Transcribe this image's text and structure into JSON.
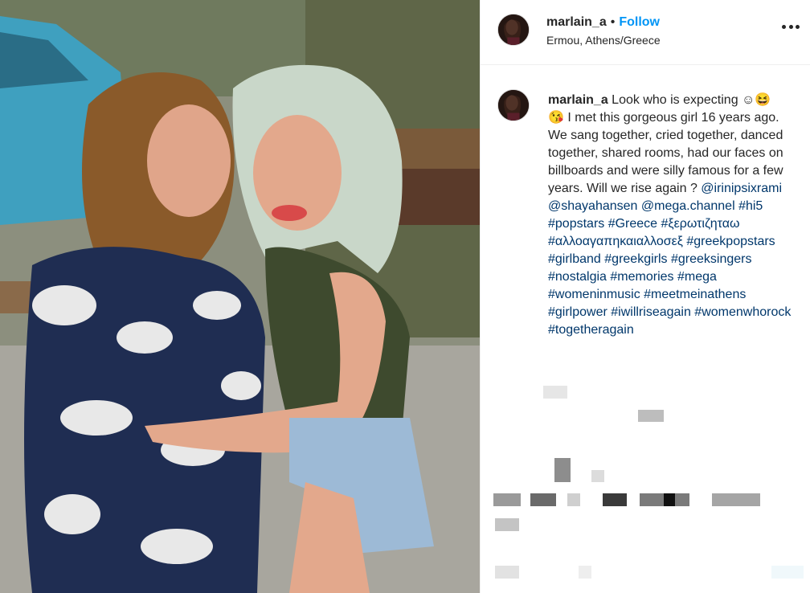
{
  "post": {
    "username": "marlain_a",
    "separator": "•",
    "follow_label": "Follow",
    "location": "Ermou, Athens/Greece"
  },
  "caption": {
    "username": "marlain_a",
    "text": "Look who is expecting ☺😆\n😘 I met this gorgeous girl 16 years ago. We sang together, cried together, danced together, shared rooms, had our faces on billboards and were silly famous for a few years. Will we rise again ? ",
    "mentions_and_tags": "@irinipsixrami @shayahansen @mega.channel #hi5 #popstars #Greece #ξερωτιζηταω #αλλοαγαπηκαιαλλοσεξ #greekpopstars #girlband #greekgirls #greeksingers #nostalgia #memories #mega #womeninmusic #meetmeinathens #girlpower #iwillriseagain #womenwhorock #togetheragain"
  },
  "colors": {
    "link": "#00376b",
    "follow": "#0095f6",
    "text": "#262626"
  },
  "icons": {
    "more": "more-horizontal-icon"
  }
}
